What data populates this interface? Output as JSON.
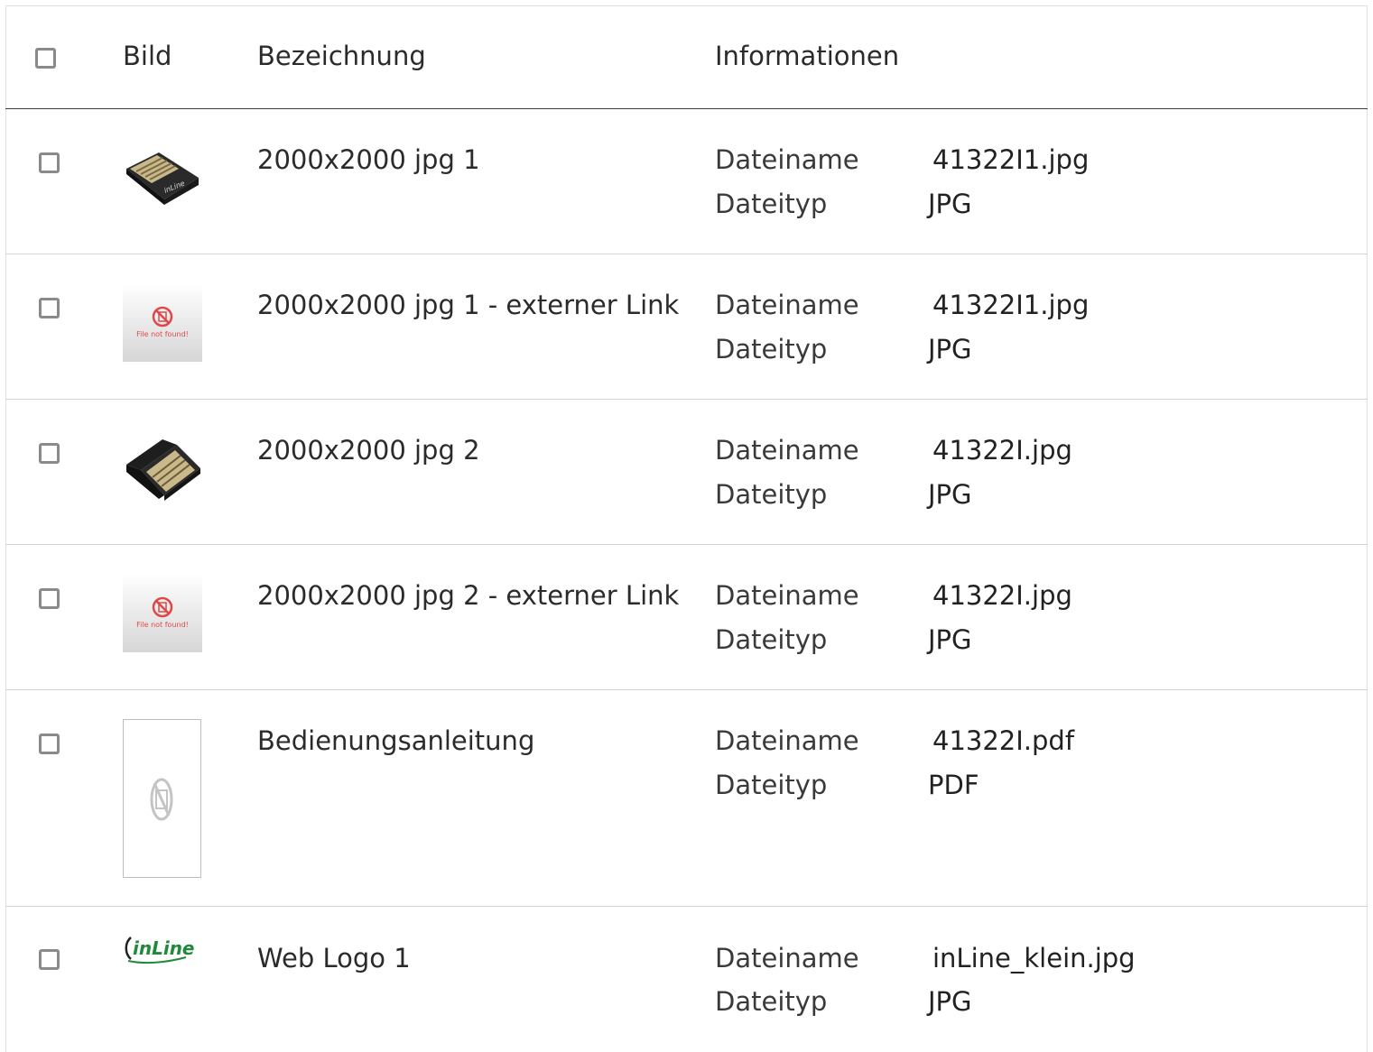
{
  "table": {
    "headers": {
      "image": "Bild",
      "name": "Bezeichnung",
      "info": "Informationen"
    },
    "not_found_text": "File not found!",
    "logo_text": "inLine",
    "rows": [
      {
        "name": "2000x2000 jpg 1",
        "thumbnail": "usb-adapter-top-view",
        "info": [
          {
            "label": "Dateiname",
            "value": "41322I1.jpg"
          },
          {
            "label": "Dateityp",
            "value": "JPG"
          }
        ]
      },
      {
        "name": "2000x2000 jpg 1 - externer Link",
        "thumbnail": "file-not-found",
        "info": [
          {
            "label": "Dateiname",
            "value": "41322I1.jpg"
          },
          {
            "label": "Dateityp",
            "value": "JPG"
          }
        ]
      },
      {
        "name": "2000x2000 jpg 2",
        "thumbnail": "usb-adapter-contacts-view",
        "info": [
          {
            "label": "Dateiname",
            "value": "41322I.jpg"
          },
          {
            "label": "Dateityp",
            "value": "JPG"
          }
        ]
      },
      {
        "name": "2000x2000 jpg 2 - externer Link",
        "thumbnail": "file-not-found",
        "info": [
          {
            "label": "Dateiname",
            "value": "41322I.jpg"
          },
          {
            "label": "Dateityp",
            "value": "JPG"
          }
        ]
      },
      {
        "name": "Bedienungsanleitung",
        "thumbnail": "pdf-document",
        "info": [
          {
            "label": "Dateiname",
            "value": "41322I.pdf"
          },
          {
            "label": "Dateityp",
            "value": "PDF"
          }
        ]
      },
      {
        "name": "Web Logo 1",
        "thumbnail": "inline-logo",
        "info": [
          {
            "label": "Dateiname",
            "value": "inLine_klein.jpg"
          },
          {
            "label": "Dateityp",
            "value": "JPG"
          }
        ]
      }
    ]
  },
  "colors": {
    "checkbox_border": "#8a8a8a",
    "header_divider": "#3c3c3c",
    "row_divider": "#d4d4d4",
    "not_found_red": "#e04848",
    "logo_green": "#1f8a3a"
  }
}
